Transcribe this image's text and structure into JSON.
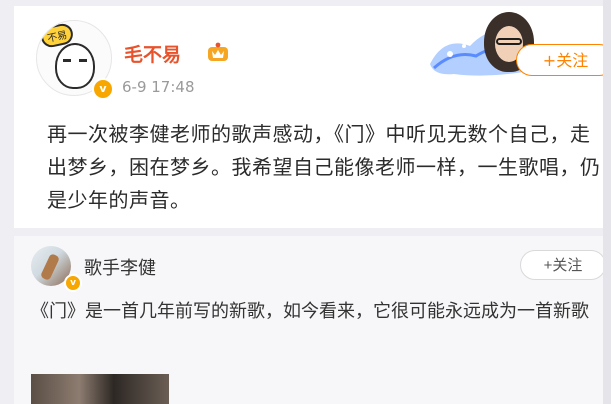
{
  "post": {
    "username": "毛不易",
    "timestamp": "6-9 17:48",
    "follow_label": "+关注",
    "avatar_sticker": "不易",
    "text": "再一次被李健老师的歌声感动，《门》中听见无数个自己，走出梦乡，困在梦乡。我希望自己能像老师一样，一生歌唱，仍是少年的声音。"
  },
  "repost": {
    "author": "歌手李健",
    "follow_label": "+关注",
    "text": "《门》是一首几年前写的新歌，如今看来，它很可能永远成为一首新歌"
  },
  "colors": {
    "username": "#e8532b",
    "follow_accent": "#ff8200",
    "verified_badge": "#f7a700"
  },
  "icons": [
    "vip-crown-icon",
    "verified-badge-icon",
    "plus-icon"
  ]
}
